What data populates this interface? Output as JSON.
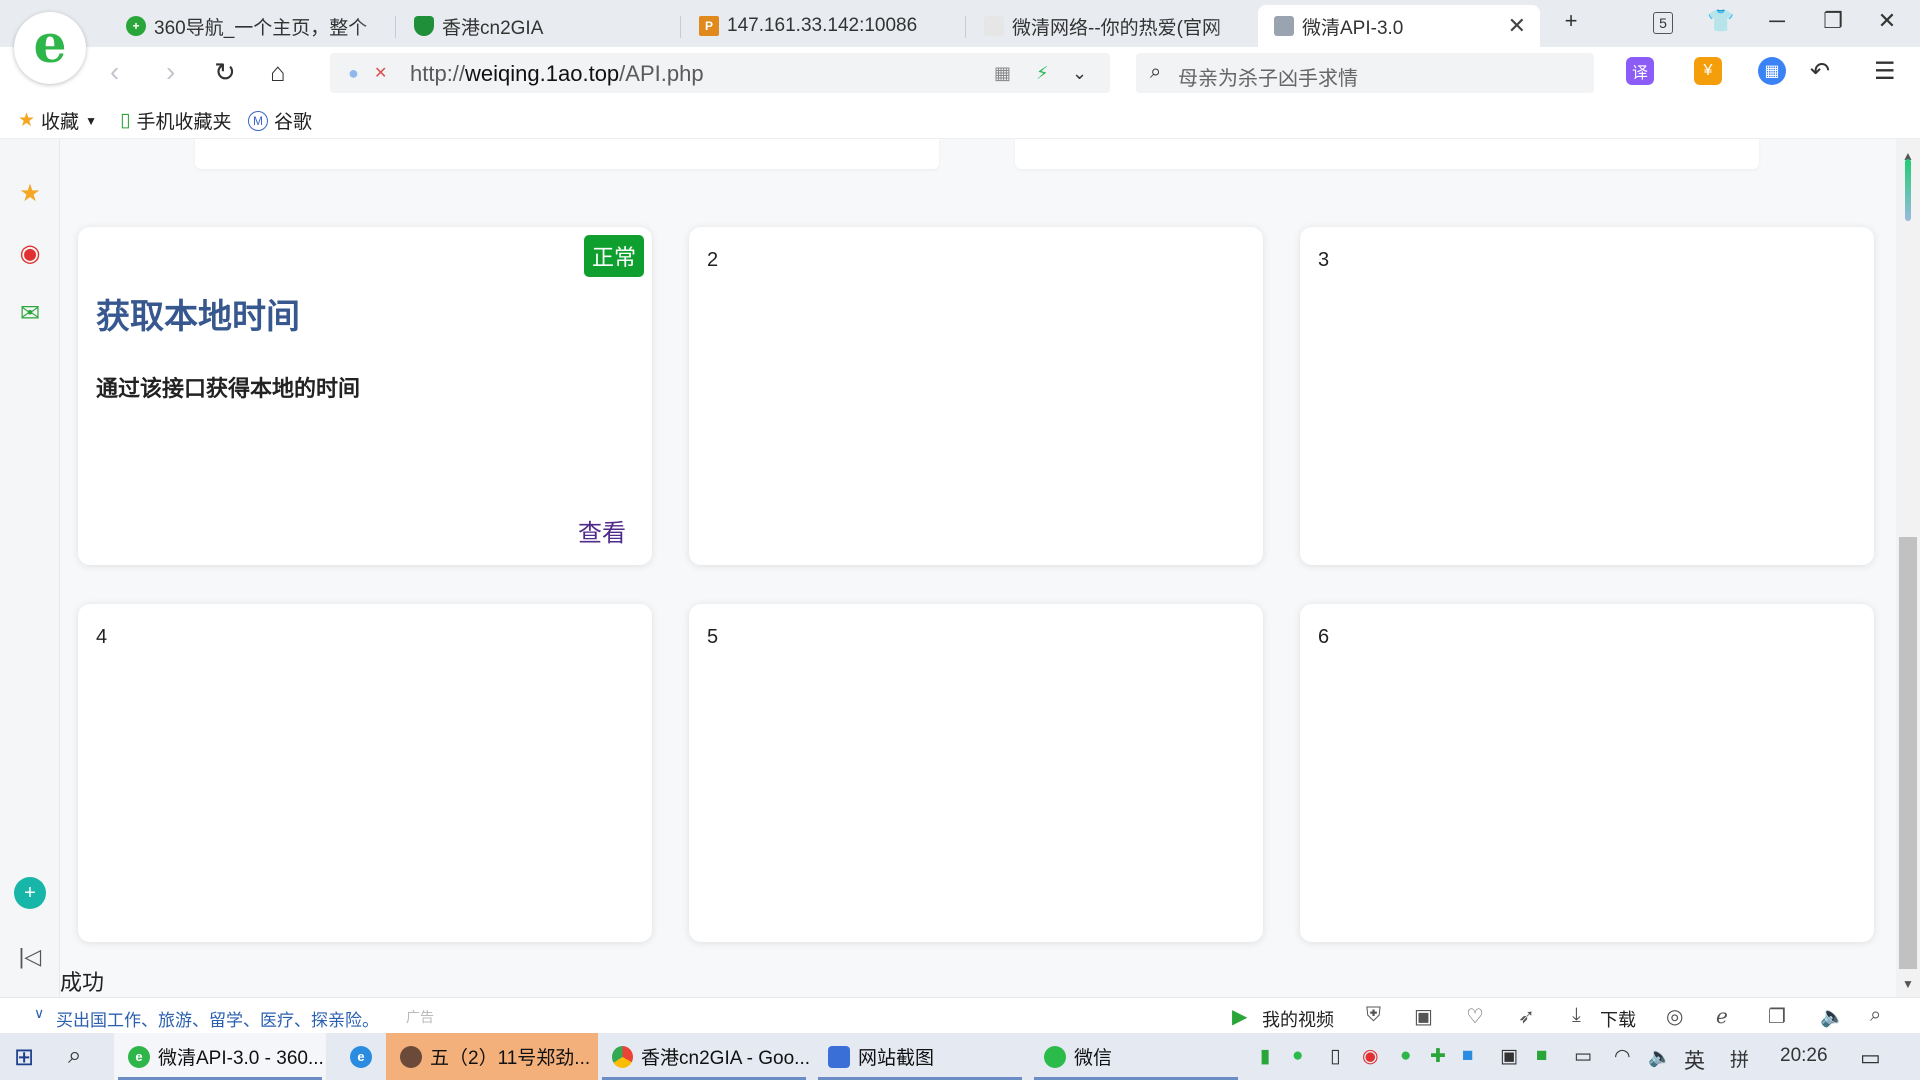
{
  "browser": {
    "tabs": [
      {
        "title": "360导航_一个主页，整个",
        "icon": "navigation-plus-icon",
        "color": "#2aa53a"
      },
      {
        "title": "香港cn2GIA",
        "icon": "shield-icon",
        "color": "#1f8f3a"
      },
      {
        "title": "147.161.33.142:10086",
        "icon": "pma-icon",
        "color": "#e08a1e"
      },
      {
        "title": "微清网络--你的热爱(官网",
        "icon": "page-icon",
        "color": "#aaaaaa"
      },
      {
        "title": "微清API-3.0",
        "icon": "page-icon",
        "color": "#888888",
        "active": true
      }
    ],
    "tab_count": "5",
    "url_prefix": "http://",
    "url_host": "weiqing.1ao.top",
    "url_path": "/API.php",
    "search_text": "母亲为杀子凶手求情",
    "translate_label": "译"
  },
  "bookmarks": [
    {
      "label": "收藏",
      "icon": "star-icon"
    },
    {
      "label": "手机收藏夹",
      "icon": "phone-icon"
    },
    {
      "label": "谷歌",
      "icon": "m-icon"
    }
  ],
  "cards": [
    {
      "title": "获取本地时间",
      "description": "通过该接口获得本地的时间",
      "status": "正常",
      "link": "查看"
    },
    {
      "number": "2"
    },
    {
      "number": "3"
    },
    {
      "number": "4"
    },
    {
      "number": "5"
    },
    {
      "number": "6"
    }
  ],
  "result_text": "成功",
  "statusbar": {
    "news": "买出国工作、旅游、留学、医疗、探亲险。",
    "ad": "广告",
    "my_video": "我的视频",
    "download": "下载"
  },
  "taskbar": {
    "tasks": [
      "微清API-3.0 - 360...",
      "五（2）11号郑劲...",
      "香港cn2GIA - Goo...",
      "网站截图",
      "微信"
    ],
    "ime_lang": "英",
    "ime_mode": "拼",
    "time": "20:26"
  },
  "colors": {
    "status_green": "#0e9f2f",
    "title_blue": "#37578f",
    "link_purple": "#4f2a8a",
    "taskbar_active": "#f3b07a"
  }
}
